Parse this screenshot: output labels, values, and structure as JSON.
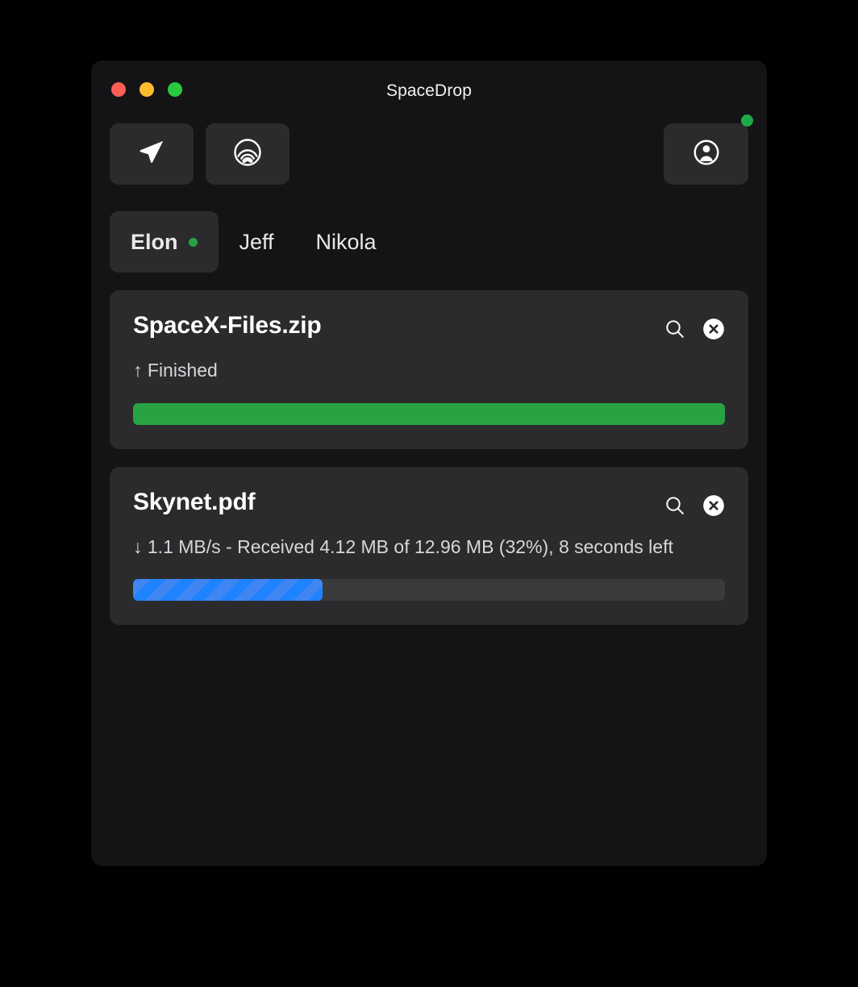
{
  "window": {
    "title": "SpaceDrop",
    "traffic_lights": [
      {
        "name": "close",
        "color": "#fa5e55"
      },
      {
        "name": "minimize",
        "color": "#fdbc2d"
      },
      {
        "name": "maximize",
        "color": "#2ac940"
      }
    ]
  },
  "toolbar": {
    "send_label": "send-file",
    "airdrop_label": "airdrop-discovery",
    "profile_label": "profile",
    "presence_color": "#1fa94b"
  },
  "tabs": [
    {
      "label": "Elon",
      "active": true,
      "dot": true
    },
    {
      "label": "Jeff",
      "active": false,
      "dot": false
    },
    {
      "label": "Nikola",
      "active": false,
      "dot": false
    }
  ],
  "transfers": [
    {
      "filename": "SpaceX-Files.zip",
      "direction": "up",
      "status": "↑ Finished",
      "progress_percent": 100,
      "progress_style": "solid",
      "progress_color": "#27a343"
    },
    {
      "filename": "Skynet.pdf",
      "direction": "down",
      "status": "↓ 1.1 MB/s - Received 4.12 MB of 12.96 MB (32%), 8 seconds left",
      "progress_percent": 32,
      "progress_style": "striped",
      "progress_color": "#1f82ff"
    }
  ]
}
